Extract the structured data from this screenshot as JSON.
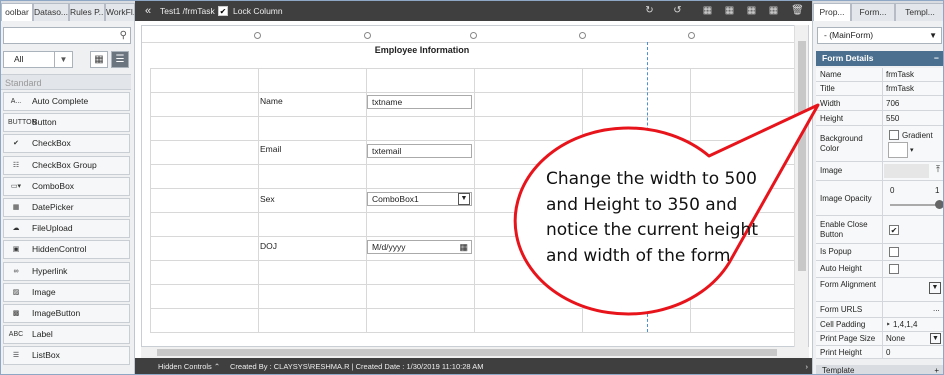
{
  "left_panel": {
    "tabs": [
      "oolbar",
      "Dataso...",
      "Rules P...",
      "WorkFl..."
    ],
    "filter_value": "All",
    "group_label": "Standard",
    "tools": [
      {
        "label": "Auto Complete",
        "icon": "A..."
      },
      {
        "label": "Button",
        "icon": "BUTTON"
      },
      {
        "label": "CheckBox",
        "icon": "✔"
      },
      {
        "label": "CheckBox Group",
        "icon": "☷"
      },
      {
        "label": "ComboBox",
        "icon": "▭▾"
      },
      {
        "label": "DatePicker",
        "icon": "▦"
      },
      {
        "label": "FileUpload",
        "icon": "☁"
      },
      {
        "label": "HiddenControl",
        "icon": "▣"
      },
      {
        "label": "Hyperlink",
        "icon": "∞"
      },
      {
        "label": "Image",
        "icon": "▨"
      },
      {
        "label": "ImageButton",
        "icon": "▩"
      },
      {
        "label": "Label",
        "icon": "ABC"
      },
      {
        "label": "ListBox",
        "icon": "☰"
      }
    ]
  },
  "toolbar": {
    "collapse": "«",
    "breadcrumb": "Test1 /frmTask",
    "lock_label": "Lock Column",
    "lock_checked": "✔"
  },
  "form": {
    "title": "Employee Information",
    "rows": [
      {
        "label": "Name",
        "value": "txtname"
      },
      {
        "label": "Email",
        "value": "txtemail"
      },
      {
        "label": "Sex",
        "value": "ComboBox1"
      },
      {
        "label": "DOJ",
        "value": "M/d/yyyy"
      }
    ]
  },
  "status": {
    "hidden_controls": "Hidden Controls",
    "created": "Created By : CLAYSYS\\RESHMA.R | Created Date : 1/30/2019 11:10:28 AM"
  },
  "right_panel": {
    "tabs": [
      "Prop...",
      "Form...",
      "Templ..."
    ],
    "selector": "- (MainForm)",
    "section": "Form Details",
    "props": {
      "name": {
        "label": "Name",
        "value": "frmTask"
      },
      "title": {
        "label": "Title",
        "value": "frmTask"
      },
      "width": {
        "label": "Width",
        "value": "706"
      },
      "height": {
        "label": "Height",
        "value": "550"
      },
      "bg": {
        "label": "Background Color",
        "value": "Gradient"
      },
      "image": {
        "label": "Image"
      },
      "opacity": {
        "label": "Image Opacity",
        "min": "0",
        "max": "1"
      },
      "close": {
        "label": "Enable Close Button"
      },
      "popup": {
        "label": "Is Popup"
      },
      "autoh": {
        "label": "Auto Height"
      },
      "align": {
        "label": "Form Alignment"
      },
      "urls": {
        "label": "Form URLS",
        "value": "..."
      },
      "pad": {
        "label": "Cell Padding",
        "value": "1,4,1,4"
      },
      "pps": {
        "label": "Print Page Size",
        "value": "None"
      },
      "ph": {
        "label": "Print Height",
        "value": "0"
      }
    },
    "footer": "Template"
  },
  "callout": {
    "text": "Change the width to 500 and Height to 350 and notice the current height and width of the form",
    "colors": {
      "stroke": "#e8141c",
      "fill": "#ffffff"
    }
  }
}
